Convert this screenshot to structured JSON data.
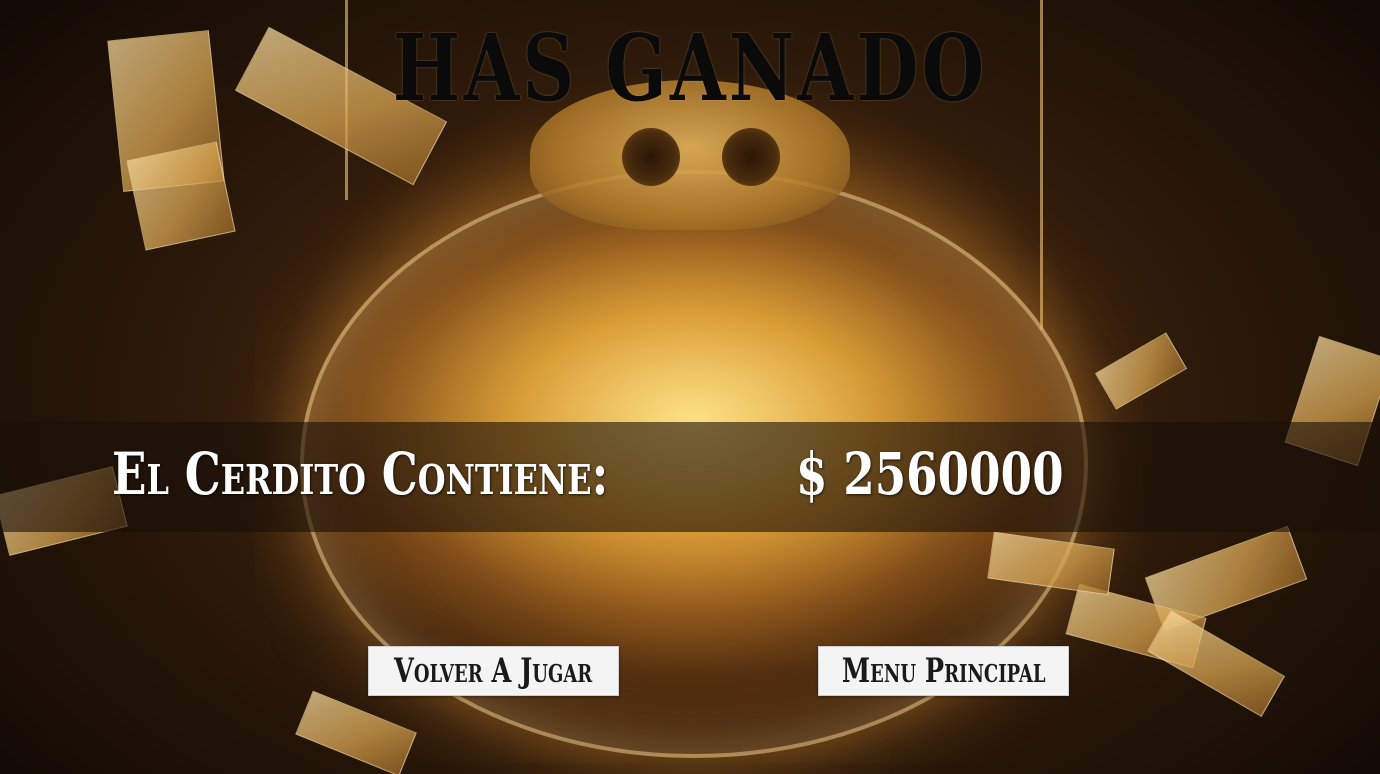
{
  "screen": {
    "title": "HAS GANADO",
    "summary_label": "El Cerdito Contiene:",
    "summary_value": "$ 2560000"
  },
  "buttons": {
    "play_again": "Volver A Jugar",
    "main_menu": "Menu Principal"
  },
  "colors": {
    "title_text": "#0a0a0a",
    "band_text": "#ffffff",
    "button_bg": "#f4f4f4",
    "button_text": "#1a1a1a",
    "background_glow": "#d68c28"
  },
  "background": {
    "icon": "piggy-bank-full-of-money-image"
  }
}
